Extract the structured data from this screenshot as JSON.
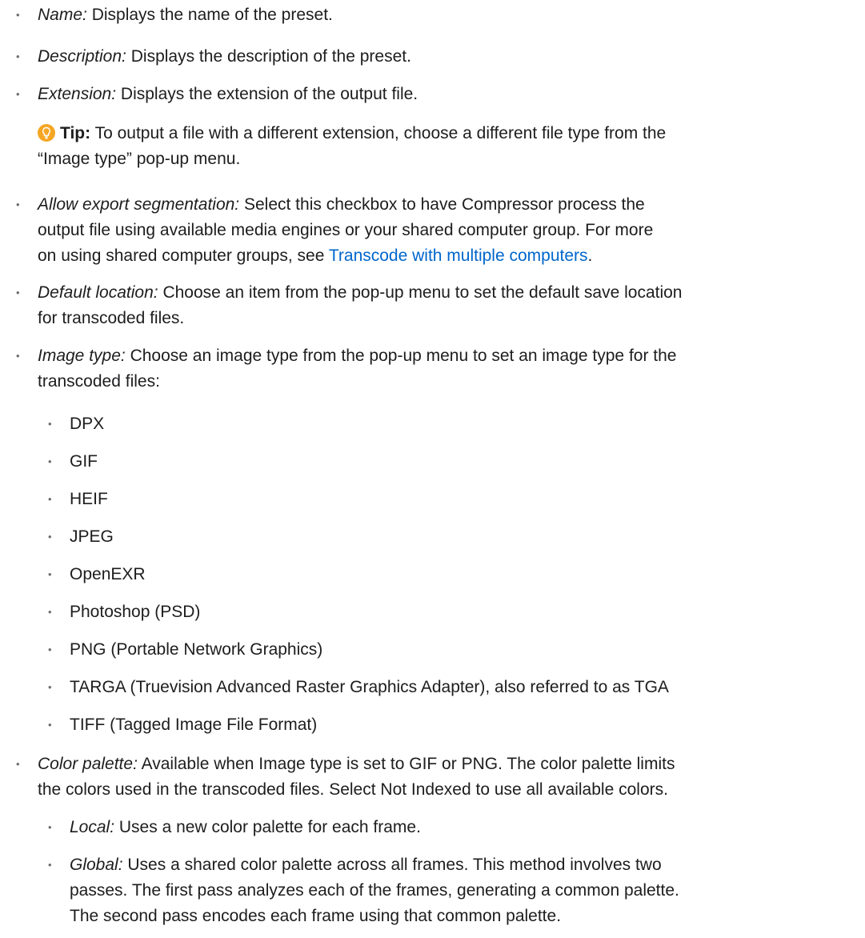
{
  "items": [
    {
      "term": "Name:",
      "text": "Displays the name of the preset."
    },
    {
      "term": "Description:",
      "text": "Displays the description of the preset."
    },
    {
      "term": "Extension:",
      "text": "Displays the extension of the output file."
    },
    {
      "tip_label": "Tip:",
      "tip_text": "To output a file with a different extension, choose a different file type from the",
      "tip_text_2": "“Image type” pop-up menu."
    },
    {
      "term": "Allow export segmentation:",
      "text": "Select this checkbox to have Compressor process the",
      "text_2": "output file using available media engines or your shared computer group. For more",
      "text_3a": "on using shared computer groups, see ",
      "link": "Transcode with multiple computers",
      "text_3b": "."
    },
    {
      "term": "Default location:",
      "text": "Choose an item from the pop-up menu to set the default save location",
      "text_2": "for transcoded files."
    },
    {
      "term": "Image type:",
      "text": "Choose an image type from the pop-up menu to set an image type for the",
      "text_2": "transcoded files:"
    },
    {
      "sub_items": [
        "DPX",
        "GIF",
        "HEIF",
        "JPEG",
        "OpenEXR",
        "Photoshop (PSD)",
        "PNG (Portable Network Graphics)",
        "TARGA (Truevision Advanced Raster Graphics Adapter), also referred to as TGA",
        "TIFF (Tagged Image File Format)"
      ]
    },
    {
      "term": "Color palette:",
      "text": "Available when Image type is set to GIF or PNG. The color palette limits",
      "text_2": "the colors used in the transcoded files. Select Not Indexed to use all available colors."
    },
    {
      "local_term": "Local:",
      "local_text": "Uses a new color palette for each frame.",
      "global_term": "Global:",
      "global_text": "Uses a shared color palette across all frames. This method involves two",
      "global_text_2": "passes. The first pass analyzes each of the frames, generating a common palette.",
      "global_text_3": "The second pass encodes each frame using that common palette."
    }
  ],
  "colors": {
    "text": "#1d1d1f",
    "link": "#0066cc",
    "tip_icon": "#f5a623"
  }
}
